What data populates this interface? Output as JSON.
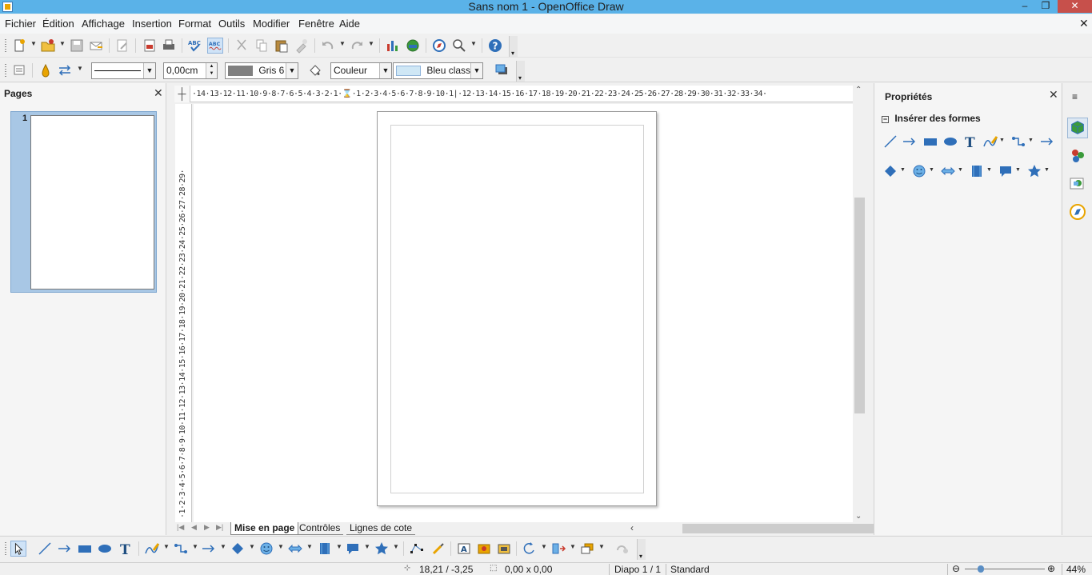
{
  "window": {
    "title": "Sans nom 1 - OpenOffice Draw",
    "minimize": "–",
    "maximize": "❐",
    "close": "✕"
  },
  "menu": [
    "Fichier",
    "Édition",
    "Affichage",
    "Insertion",
    "Format",
    "Outils",
    "Modifier",
    "Fenêtre",
    "Aide"
  ],
  "doc_close": "✕",
  "line_toolbar": {
    "line_width": "0,00cm",
    "line_color": "Gris 6",
    "area_style": "Couleur",
    "area_color": "Bleu classic",
    "line_color_hex": "#808080",
    "area_color_hex": "#cfe7f5"
  },
  "pages_panel": {
    "title": "Pages",
    "close": "✕",
    "pages": [
      {
        "number": "1"
      }
    ]
  },
  "ruler": {
    "horizontal": "·14·13·12·11·10·9·8·7·6·5·4·3·2·1·⌛·1·2·3·4·5·6·7·8·9·10·1|·12·13·14·15·16·17·18·19·20·21·22·23·24·25·26·27·28·29·30·31·32·33·34·",
    "vertical": "·1·2·3·4·5·6·7·8·9·10·11·12·13·14·15·16·17·18·19·20·21·22·23·24·25·26·27·28·29·",
    "corner": "┼"
  },
  "tabs": [
    "Mise en page",
    "Contrôles",
    "Lignes de cote"
  ],
  "tab_nav": [
    "|◀",
    "◀",
    "▶",
    "▶|"
  ],
  "properties": {
    "title": "Propriétés",
    "close": "✕",
    "section": "Insérer des formes",
    "section_toggle": "−",
    "menu": "≡"
  },
  "status": {
    "position": "18,21 / -3,25",
    "size": "0,00 x 0,00",
    "slide": "Diapo 1 / 1",
    "layout": "Standard",
    "zoom": "44%",
    "zoom_minus": "⊖",
    "zoom_plus": "⊕"
  },
  "icons": {
    "accent": "#2f6fb9",
    "warning": "#e9a400",
    "red": "#c93b2e",
    "green": "#3a9a3a"
  }
}
